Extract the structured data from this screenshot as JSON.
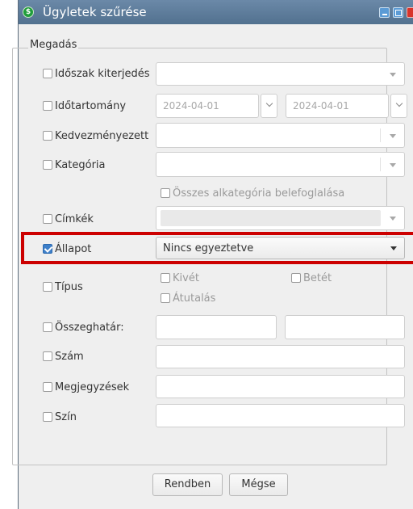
{
  "window": {
    "title": "Ügyletek szűrése",
    "app_icon_glyph": "$"
  },
  "group": {
    "title": "Megadás"
  },
  "filters": {
    "period_extent": {
      "label": "Időszak kiterjedés",
      "checked": false,
      "value": ""
    },
    "date_range": {
      "label": "Időtartomány",
      "checked": false,
      "from": "2024-04-01",
      "to": "2024-04-01"
    },
    "payee": {
      "label": "Kedvezményezett",
      "checked": false,
      "value": ""
    },
    "category": {
      "label": "Kategória",
      "checked": false,
      "value": ""
    },
    "include_subcategories": {
      "label": "Összes alkategória belefoglalása",
      "checked": false
    },
    "tags": {
      "label": "Címkék",
      "checked": false
    },
    "status": {
      "label": "Állapot",
      "checked": true,
      "value": "Nincs egyeztetve"
    },
    "type": {
      "label": "Típus",
      "checked": false,
      "options": {
        "withdrawal": "Kivét",
        "deposit": "Betét",
        "transfer": "Átutalás"
      }
    },
    "amount": {
      "label": "Összeghatár:",
      "checked": false,
      "min": "",
      "max": ""
    },
    "number": {
      "label": "Szám",
      "checked": false,
      "value": ""
    },
    "notes": {
      "label": "Megjegyzések",
      "checked": false,
      "value": ""
    },
    "color": {
      "label": "Szín",
      "checked": false,
      "value": ""
    }
  },
  "buttons": {
    "ok": "Rendben",
    "cancel": "Mégse"
  },
  "colors": {
    "titlebar": "#52718f",
    "highlight": "#cc0000",
    "checkbox_checked": "#3d7fc9"
  }
}
